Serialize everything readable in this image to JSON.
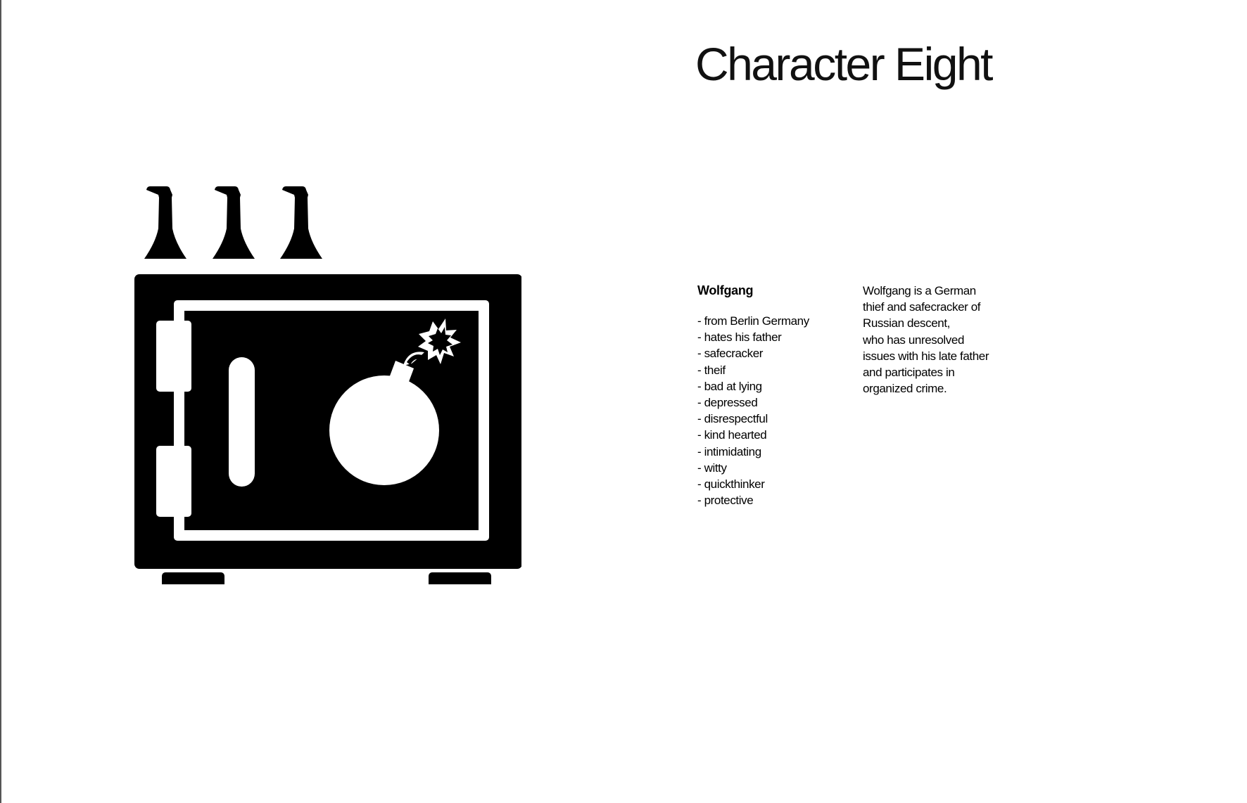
{
  "title": "Character Eight",
  "illustration": {
    "icons": [
      "bottle-icon",
      "bottle-icon",
      "bottle-icon",
      "safe-icon",
      "bomb-icon"
    ],
    "fill_color": "#000000",
    "background_color": "#ffffff"
  },
  "character": {
    "name": "Wolfgang",
    "traits": [
      "- from Berlin Germany",
      "- hates his father",
      "- safecracker",
      "- theif",
      "- bad at lying",
      "- depressed",
      "- disrespectful",
      "- kind hearted",
      "- intimidating",
      "- witty",
      "- quickthinker",
      "- protective"
    ],
    "bio_lines": [
      "Wolfgang is a German",
      "thief and safecracker of",
      "Russian descent,",
      "who has unresolved",
      "issues with his late father",
      "and participates in",
      "organized crime."
    ]
  }
}
